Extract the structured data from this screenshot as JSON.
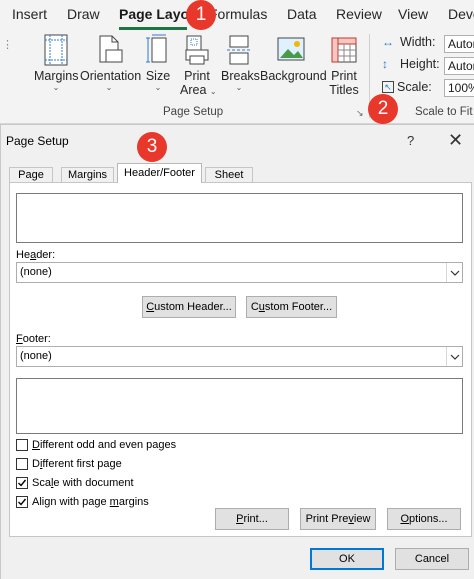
{
  "ribbon_tabs": {
    "insert": "Insert",
    "draw": "Draw",
    "page_layout": "Page Layout",
    "formulas": "Formulas",
    "data": "Data",
    "review": "Review",
    "view": "View",
    "developer": "Deve"
  },
  "badges": {
    "one": "1",
    "two": "2",
    "three": "3"
  },
  "page_setup_group": {
    "margins": "Margins",
    "orientation": "Orientation",
    "size": "Size",
    "print_area_line1": "Print",
    "print_area_line2": "Area",
    "breaks": "Breaks",
    "background": "Background",
    "print_titles_line1": "Print",
    "print_titles_line2": "Titles",
    "group_label": "Page Setup"
  },
  "scale_to_fit": {
    "width_label": "Width:",
    "width_value": "Automatic",
    "height_label": "Height:",
    "height_value": "Automatic",
    "scale_label": "Scale:",
    "scale_value": "100%",
    "group_label": "Scale to Fit"
  },
  "dialog": {
    "title": "Page Setup",
    "help": "?",
    "close": "✕",
    "tabs": {
      "page": "Page",
      "margins": "Margins",
      "header_footer": "Header/Footer",
      "sheet": "Sheet"
    },
    "header_label_pre": "He",
    "header_label_u": "a",
    "header_label_post": "der:",
    "header_value": "(none)",
    "custom_header_u": "C",
    "custom_header_rest": "ustom Header...",
    "custom_footer_pre": "C",
    "custom_footer_u": "u",
    "custom_footer_rest": "stom Footer...",
    "footer_label_u": "F",
    "footer_label_rest": "ooter:",
    "footer_value": "(none)",
    "opt_odd_even_u": "D",
    "opt_odd_even_rest": "ifferent odd and even pages",
    "opt_first_page_pre": "D",
    "opt_first_page_u": "i",
    "opt_first_page_rest": "fferent first page",
    "opt_scale_pre": "Sca",
    "opt_scale_u": "l",
    "opt_scale_rest": "e with document",
    "opt_align_pre": "Align with page ",
    "opt_align_u": "m",
    "opt_align_rest": "argins",
    "print_u": "P",
    "print_rest": "rint...",
    "preview_pre": "Print Pre",
    "preview_u": "v",
    "preview_rest": "iew",
    "options_u": "O",
    "options_rest": "ptions...",
    "ok": "OK",
    "cancel": "Cancel"
  },
  "checkboxes": {
    "different_odd_even": false,
    "different_first_page": false,
    "scale_with_document": true,
    "align_with_margins": true
  },
  "colors": {
    "accent": "#217346",
    "badge": "#e8382c",
    "icon_blue": "#2b7bd0"
  }
}
